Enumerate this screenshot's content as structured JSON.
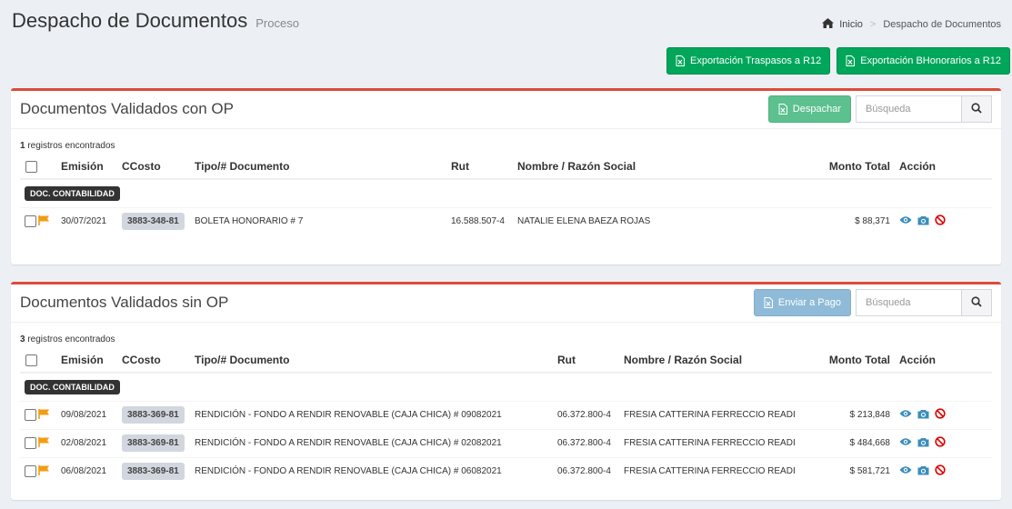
{
  "header": {
    "title": "Despacho de Documentos",
    "subtitle": "Proceso"
  },
  "breadcrumb": {
    "home": "Inicio",
    "current": "Despacho de Documentos"
  },
  "export_buttons": {
    "traspasos": "Exportación Traspasos a R12",
    "honorarios": "Exportación BHonorarios a R12"
  },
  "colors": {
    "accent_red": "#dd4b39",
    "green": "#00a65a",
    "icon_blue": "#3c8dbc",
    "forbid_red": "#dd0000",
    "flag": "#f39c12"
  },
  "columns": {
    "emision": "Emisión",
    "ccosto": "CCosto",
    "tipo": "Tipo/# Documento",
    "rut": "Rut",
    "nombre": "Nombre / Razón Social",
    "monto": "Monto Total",
    "accion": "Acción"
  },
  "panel_con_op": {
    "title": "Documentos Validados con OP",
    "action_button": "Despachar",
    "search_placeholder": "Búsqueda",
    "count": "1",
    "count_suffix": " registros encontrados",
    "group_label": "DOC. CONTABILIDAD",
    "rows": [
      {
        "emision": "30/07/2021",
        "ccosto": "3883-348-81",
        "tipo": "BOLETA HONORARIO # 7",
        "rut": "16.588.507-4",
        "nombre": "NATALIE ELENA BAEZA ROJAS",
        "monto": "$ 88,371"
      }
    ]
  },
  "panel_sin_op": {
    "title": "Documentos Validados sin OP",
    "action_button": "Enviar a Pago",
    "search_placeholder": "Búsqueda",
    "count": "3",
    "count_suffix": " registros encontrados",
    "group_label": "DOC. CONTABILIDAD",
    "rows": [
      {
        "emision": "09/08/2021",
        "ccosto": "3883-369-81",
        "tipo": "RENDICIÓN - FONDO A RENDIR RENOVABLE (CAJA CHICA) # 09082021",
        "rut": "06.372.800-4",
        "nombre": "FRESIA CATTERINA FERRECCIO READI",
        "monto": "$ 213,848"
      },
      {
        "emision": "02/08/2021",
        "ccosto": "3883-369-81",
        "tipo": "RENDICIÓN - FONDO A RENDIR RENOVABLE (CAJA CHICA) # 02082021",
        "rut": "06.372.800-4",
        "nombre": "FRESIA CATTERINA FERRECCIO READI",
        "monto": "$ 484,668"
      },
      {
        "emision": "06/08/2021",
        "ccosto": "3883-369-81",
        "tipo": "RENDICIÓN - FONDO A RENDIR RENOVABLE (CAJA CHICA) # 06082021",
        "rut": "06.372.800-4",
        "nombre": "FRESIA CATTERINA FERRECCIO READI",
        "monto": "$ 581,721"
      }
    ]
  }
}
